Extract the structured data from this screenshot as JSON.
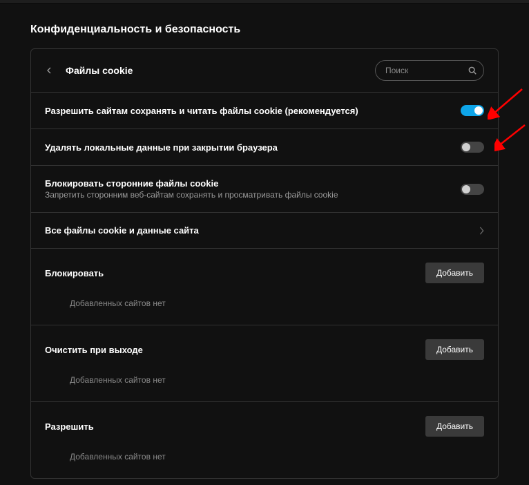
{
  "page_title": "Конфиденциальность и безопасность",
  "header": {
    "title": "Файлы cookie",
    "search_placeholder": "Поиск"
  },
  "settings": {
    "allow_cookies": {
      "label": "Разрешить сайтам сохранять и читать файлы cookie (рекомендуется)",
      "enabled": true
    },
    "clear_on_exit": {
      "label": "Удалять локальные данные при закрытии браузера",
      "enabled": false
    },
    "block_third_party": {
      "label": "Блокировать сторонние файлы cookie",
      "desc": "Запретить сторонним веб-сайтам сохранять и просматривать файлы cookie",
      "enabled": false
    },
    "all_cookies_link": "Все файлы cookie и данные сайта"
  },
  "sections": {
    "block": {
      "title": "Блокировать",
      "add_label": "Добавить",
      "empty": "Добавленных сайтов нет"
    },
    "clear": {
      "title": "Очистить при выходе",
      "add_label": "Добавить",
      "empty": "Добавленных сайтов нет"
    },
    "allow": {
      "title": "Разрешить",
      "add_label": "Добавить",
      "empty": "Добавленных сайтов нет"
    }
  },
  "colors": {
    "toggle_on": "#0ea5e9",
    "annotation_arrow": "#ff0000"
  }
}
